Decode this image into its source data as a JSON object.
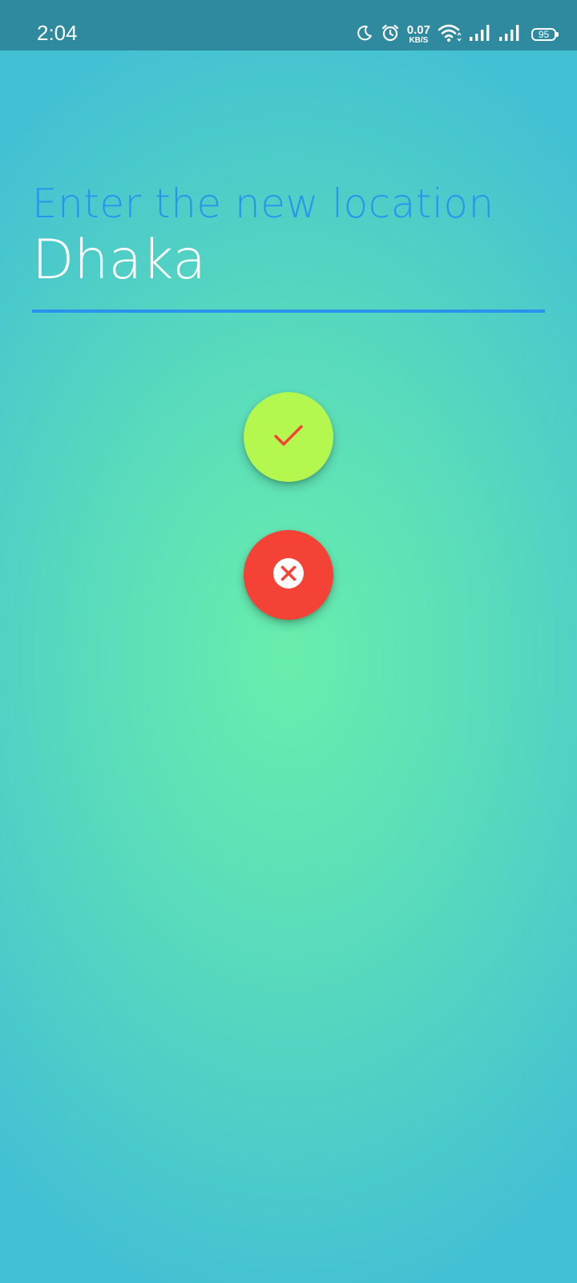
{
  "status_bar": {
    "time": "2:04",
    "net_speed_value": "0.07",
    "net_speed_unit": "KB/S",
    "battery_level": "95",
    "icons": [
      "moon-icon",
      "alarm-icon",
      "wifi-icon",
      "signal-icon",
      "signal-icon",
      "battery-icon"
    ]
  },
  "form": {
    "prompt": "Enter the new location",
    "location_value": "Dhaka"
  },
  "actions": {
    "confirm_icon": "check-icon",
    "cancel_icon": "close-circle-icon"
  },
  "colors": {
    "status_bar_bg": "#2f8a9f",
    "accent_blue": "#2a93ee",
    "confirm_bg": "#b4f74e",
    "confirm_icon": "#f44336",
    "cancel_bg": "#f44336",
    "gradient_center": "#68eeac",
    "gradient_edge": "#44c0d4"
  }
}
